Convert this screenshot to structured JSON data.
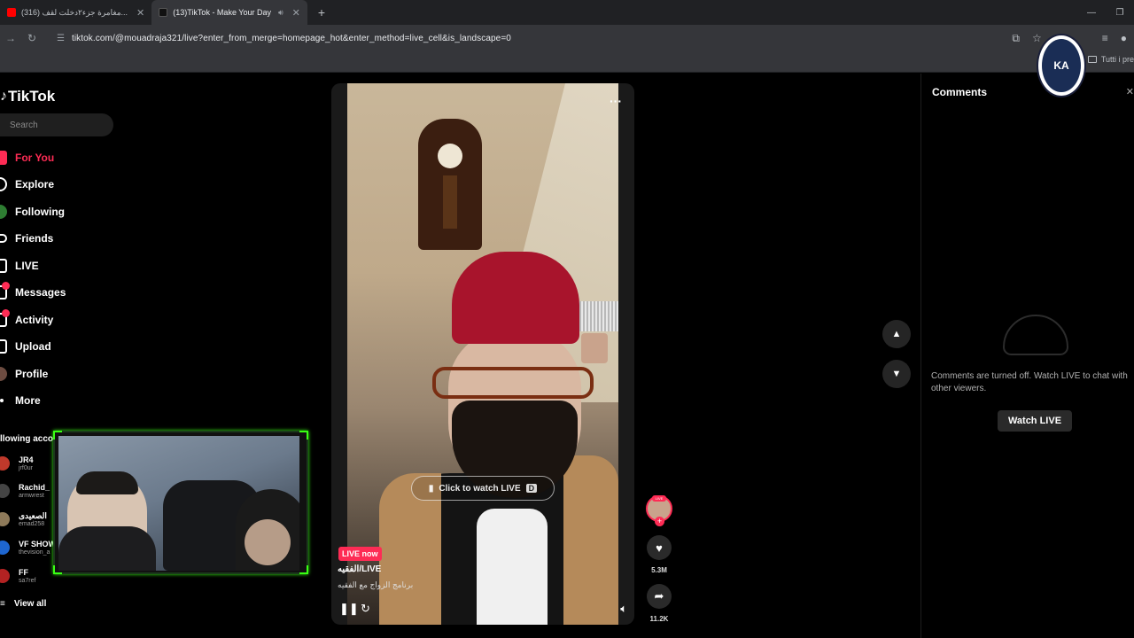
{
  "browser": {
    "tabs": [
      {
        "label": "(316) مغامرة جزء٢دخلت لقف...",
        "favicon_color": "#ff0000"
      },
      {
        "label": "(13)TikTok - Make Your Day",
        "favicon_color": "#000000"
      }
    ],
    "new_tab": "+",
    "url": "tiktok.com/@mouadraja321/live?enter_from_merge=homepage_hot&enter_method=live_cell&is_landscape=0",
    "bookmarks_all": "Tutti i pre"
  },
  "tiktok": {
    "logo": "TikTok",
    "search_placeholder": "Search",
    "nav": [
      {
        "label": "For You"
      },
      {
        "label": "Explore"
      },
      {
        "label": "Following"
      },
      {
        "label": "Friends"
      },
      {
        "label": "LIVE"
      },
      {
        "label": "Messages"
      },
      {
        "label": "Activity"
      },
      {
        "label": "Upload"
      },
      {
        "label": "Profile"
      },
      {
        "label": "More"
      }
    ],
    "following_title": "llowing acco",
    "following": [
      {
        "name": "JR4",
        "user": "jrf0ur",
        "color": "#c0392b"
      },
      {
        "name": "Rachid_",
        "user": "armwrest",
        "color": "#444444"
      },
      {
        "name": "الصعيدى",
        "user": "emad258",
        "color": "#8e7a5a"
      },
      {
        "name": "VF SHOW",
        "user": "thevision_a",
        "color": "#1e66d0"
      },
      {
        "name": "FF",
        "user": "sa7ref",
        "color": "#b22222"
      }
    ],
    "view_all": "View all"
  },
  "video": {
    "watch_live": "Click to watch LIVE",
    "watch_live_key": "D",
    "live_now": "LIVE now",
    "live_user": "الفقيه/LIVE",
    "live_desc": "برنامج الزواج مع الفقيه",
    "likes": "5.3M",
    "shares": "11.2K",
    "avatar_tag": "LIVE"
  },
  "comments": {
    "title": "Comments",
    "off_message": "Comments are turned off. Watch LIVE to chat with other viewers.",
    "watch_button": "Watch LIVE"
  },
  "badge": {
    "text": "KA"
  },
  "colors": {
    "accent": "#fe2c55",
    "bg": "#000000",
    "chrome": "#35363a"
  }
}
